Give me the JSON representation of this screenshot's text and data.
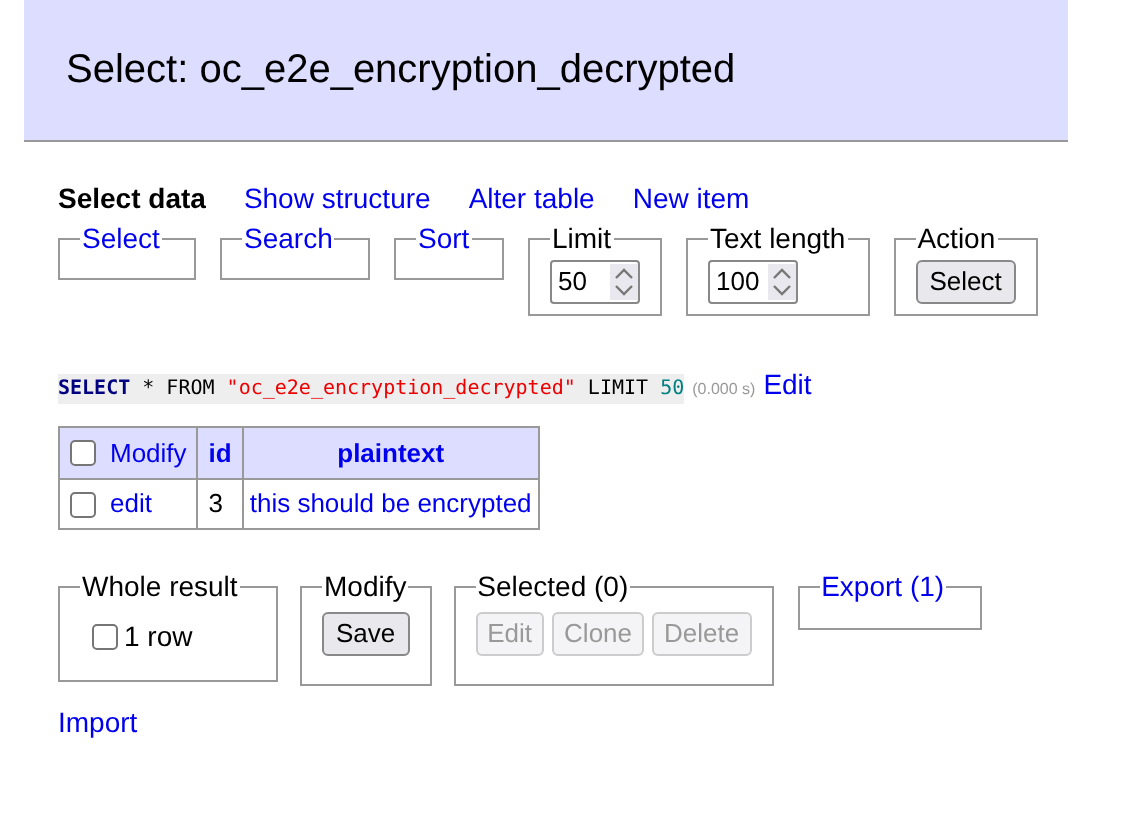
{
  "title": "Select: oc_e2e_encryption_decrypted",
  "nav": [
    {
      "label": "Select data",
      "selected": true
    },
    {
      "label": "Show structure",
      "selected": false
    },
    {
      "label": "Alter table",
      "selected": false
    },
    {
      "label": "New item",
      "selected": false
    }
  ],
  "filters": [
    {
      "kind": "link",
      "legend": "Select"
    },
    {
      "kind": "link",
      "legend": "Search"
    },
    {
      "kind": "link",
      "legend": "Sort"
    },
    {
      "kind": "number",
      "legend": "Limit",
      "value": "50"
    },
    {
      "kind": "number",
      "legend": "Text length",
      "value": "100"
    },
    {
      "kind": "button",
      "legend": "Action",
      "button": "Select"
    }
  ],
  "query": {
    "tokens": [
      {
        "kind": "keyword",
        "text": "SELECT"
      },
      {
        "kind": "plain",
        "text": " * FROM "
      },
      {
        "kind": "string",
        "text": "\"oc_e2e_encryption_decrypted\""
      },
      {
        "kind": "plain",
        "text": " LIMIT "
      },
      {
        "kind": "number",
        "text": "50"
      }
    ],
    "time": "(0.000 s)",
    "edit": "Edit"
  },
  "table": {
    "columns": [
      "Modify",
      "id",
      "plaintext"
    ],
    "all_checked": false,
    "rows": [
      {
        "checked": false,
        "action": "edit",
        "id": "3",
        "plaintext": "this should be encrypted"
      }
    ]
  },
  "actions": {
    "whole_result": {
      "legend": "Whole result",
      "label": "1 row",
      "checked": false
    },
    "modify": {
      "legend": "Modify",
      "button": "Save"
    },
    "selected": {
      "legend": "Selected (0)",
      "buttons": [
        {
          "label": "Edit",
          "disabled": true
        },
        {
          "label": "Clone",
          "disabled": true
        },
        {
          "label": "Delete",
          "disabled": true
        }
      ]
    },
    "export": "Export (1)"
  },
  "import": "Import"
}
